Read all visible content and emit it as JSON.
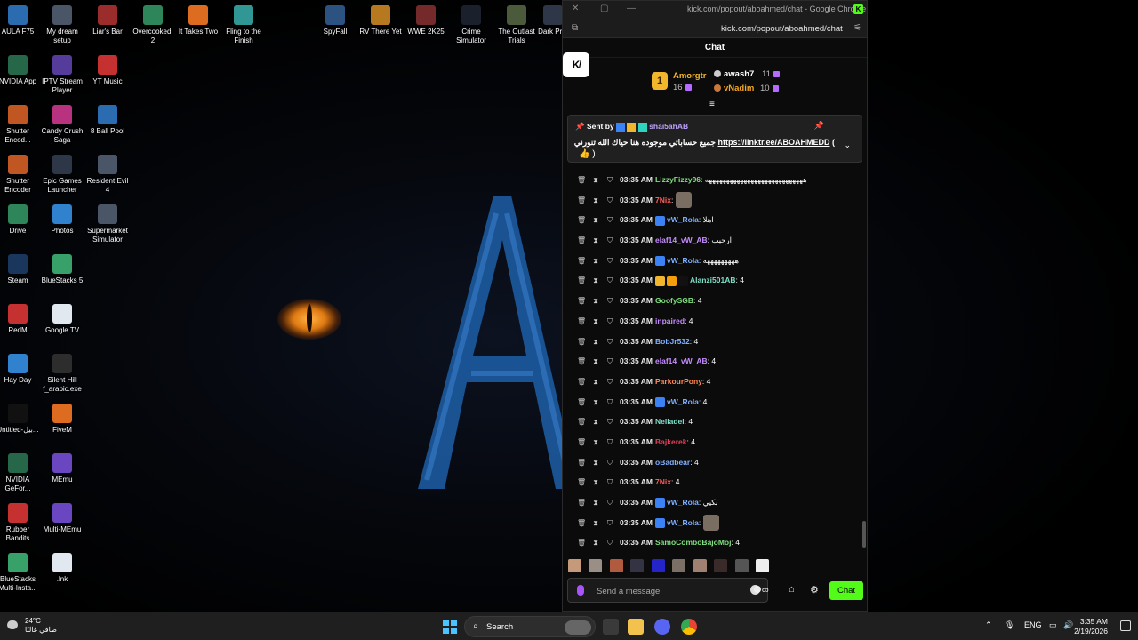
{
  "desktop": {
    "icons": [
      {
        "label": "AULA F75",
        "color": "#2b6cb0"
      },
      {
        "label": "My dream setup",
        "color": "#4a5568"
      },
      {
        "label": "Liar's Bar",
        "color": "#9b2c2c"
      },
      {
        "label": "Overcooked! 2",
        "color": "#2f855a"
      },
      {
        "label": "It Takes Two",
        "color": "#dd6b20"
      },
      {
        "label": "Fling to the Finish",
        "color": "#319795"
      },
      {
        "label": "SpyFall",
        "color": "#2c5282"
      },
      {
        "label": "RV There Yet",
        "color": "#b7791f"
      },
      {
        "label": "WWE 2K25",
        "color": "#742a2a"
      },
      {
        "label": "Crime Simulator",
        "color": "#1a202c"
      },
      {
        "label": "The Outlast Trials",
        "color": "#4a5a3a"
      },
      {
        "label": "Dark Prot",
        "color": "#2d3748"
      },
      {
        "label": "NVIDIA App",
        "color": "#276749"
      },
      {
        "label": "IPTV Stream Player",
        "color": "#553c9a"
      },
      {
        "label": "YT Music",
        "color": "#c53030"
      },
      {
        "label": "Shutter Encod...",
        "color": "#c05621"
      },
      {
        "label": "Candy Crush Saga",
        "color": "#b83280"
      },
      {
        "label": "8 Ball Pool",
        "color": "#2b6cb0"
      },
      {
        "label": "Shutter Encoder",
        "color": "#c05621"
      },
      {
        "label": "Epic Games Launcher",
        "color": "#2d3748"
      },
      {
        "label": "Resident Evil 4",
        "color": "#4a5568"
      },
      {
        "label": "Drive",
        "color": "#2f855a"
      },
      {
        "label": "Photos",
        "color": "#3182ce"
      },
      {
        "label": "Supermarket Simulator",
        "color": "#4a5568"
      },
      {
        "label": "Steam",
        "color": "#1a365d"
      },
      {
        "label": "BlueStacks 5",
        "color": "#38a169"
      },
      {
        "label": "RedM",
        "color": "#c53030"
      },
      {
        "label": "Google TV",
        "color": "#e2e8f0"
      },
      {
        "label": "Hay Day",
        "color": "#3182ce"
      },
      {
        "label": "Silent Hill f_arabic.exe",
        "color": "#2d2d2d"
      },
      {
        "label": "Untitled-بيل...",
        "color": "#111111"
      },
      {
        "label": "FiveM",
        "color": "#dd6b20"
      },
      {
        "label": "NVIDIA GeFor...",
        "color": "#276749"
      },
      {
        "label": "MEmu",
        "color": "#6b46c1"
      },
      {
        "label": "Rubber Bandits",
        "color": "#c53030"
      },
      {
        "label": "Multi-MEmu",
        "color": "#6b46c1"
      },
      {
        "label": "BlueStacks Multi-Insta...",
        "color": "#38a169"
      },
      {
        "label": ".lnk",
        "color": "#e2e8f0"
      }
    ]
  },
  "browser": {
    "window_title": "kick.com/popout/aboahmed/chat - Google Chrome",
    "url": "kick.com/popout/aboahmed/chat"
  },
  "chat": {
    "header": "Chat",
    "leaderboard": {
      "first": {
        "name": "Amorgtr",
        "count": "16"
      },
      "second": {
        "name": "awash7",
        "count": "11"
      },
      "third": {
        "name": "vNadim",
        "count": "10"
      }
    },
    "pinned": {
      "sent_by_label": "Sent by",
      "user": "shai5ahAB",
      "message_text": "جميع حساباتي موجوده هنا حياك الله تنورني",
      "link": "https://linktr.ee/ABOAHMEDD",
      "paren_open": "(",
      "paren_close": ")",
      "emoji": "👍"
    },
    "messages": [
      {
        "time": "03:35 AM",
        "user": "LizzyFizzy96",
        "color": "#7ee07e",
        "text": ": ههههههههههههههههههههههههههههه",
        "badges": []
      },
      {
        "time": "03:35 AM",
        "user": "7Nix",
        "color": "#ff5a5a",
        "text": ":",
        "badges": [],
        "emote": true
      },
      {
        "time": "03:35 AM",
        "user": "vW_Rola",
        "color": "#7fb0ff",
        "text": ": اهلا",
        "badges": [
          "#3b82f6"
        ]
      },
      {
        "time": "03:35 AM",
        "user": "elaf14_vW_AB",
        "color": "#c58cff",
        "text": ": ارحبب",
        "badges": []
      },
      {
        "time": "03:35 AM",
        "user": "vW_Rola",
        "color": "#7fb0ff",
        "text": ": هههههههههه",
        "badges": [
          "#3b82f6"
        ]
      },
      {
        "time": "03:35 AM",
        "user": "Alanzi501AB",
        "color": "#7ee0c7",
        "text": ": 4",
        "badges": [
          "#f1b62b",
          "#f59e0b",
          "#111111"
        ]
      },
      {
        "time": "03:35 AM",
        "user": "GoofySGB",
        "color": "#7ee07e",
        "text": ": 4",
        "badges": []
      },
      {
        "time": "03:35 AM",
        "user": "inpaired",
        "color": "#c58cff",
        "text": ": 4",
        "badges": []
      },
      {
        "time": "03:35 AM",
        "user": "BobJr532",
        "color": "#7fb0ff",
        "text": ": 4",
        "badges": []
      },
      {
        "time": "03:35 AM",
        "user": "elaf14_vW_AB",
        "color": "#c58cff",
        "text": ": 4",
        "badges": []
      },
      {
        "time": "03:35 AM",
        "user": "ParkourPony",
        "color": "#ff8a5a",
        "text": ": 4",
        "badges": []
      },
      {
        "time": "03:35 AM",
        "user": "vW_Rola",
        "color": "#7fb0ff",
        "text": ": 4",
        "badges": [
          "#3b82f6"
        ]
      },
      {
        "time": "03:35 AM",
        "user": "Nelladel",
        "color": "#7ee0c7",
        "text": ": 4",
        "badges": []
      },
      {
        "time": "03:35 AM",
        "user": "Bajkerek",
        "color": "#e0405a",
        "text": ": 4",
        "badges": []
      },
      {
        "time": "03:35 AM",
        "user": "oBadbear",
        "color": "#7fb0ff",
        "text": ": 4",
        "badges": []
      },
      {
        "time": "03:35 AM",
        "user": "7Nix",
        "color": "#ff5a5a",
        "text": ": 4",
        "badges": []
      },
      {
        "time": "03:35 AM",
        "user": "vW_Rola",
        "color": "#7fb0ff",
        "text": ": بكيي",
        "badges": [
          "#3b82f6"
        ]
      },
      {
        "time": "03:35 AM",
        "user": "vW_Rola",
        "color": "#7fb0ff",
        "text": ":",
        "badges": [
          "#3b82f6"
        ],
        "emote": true
      },
      {
        "time": "03:35 AM",
        "user": "SamoComboBajoMoj",
        "color": "#7ee07e",
        "text": ": 4",
        "badges": []
      }
    ],
    "composer": {
      "placeholder": "Send a message"
    },
    "send_label": "Chat",
    "accent": "#53fc18"
  },
  "taskbar": {
    "weather_temp": "24°C",
    "weather_desc": "صافي غالبًا",
    "search_label": "Search",
    "lang": "ENG",
    "time": "3:35 AM",
    "date": "2/19/2026"
  }
}
